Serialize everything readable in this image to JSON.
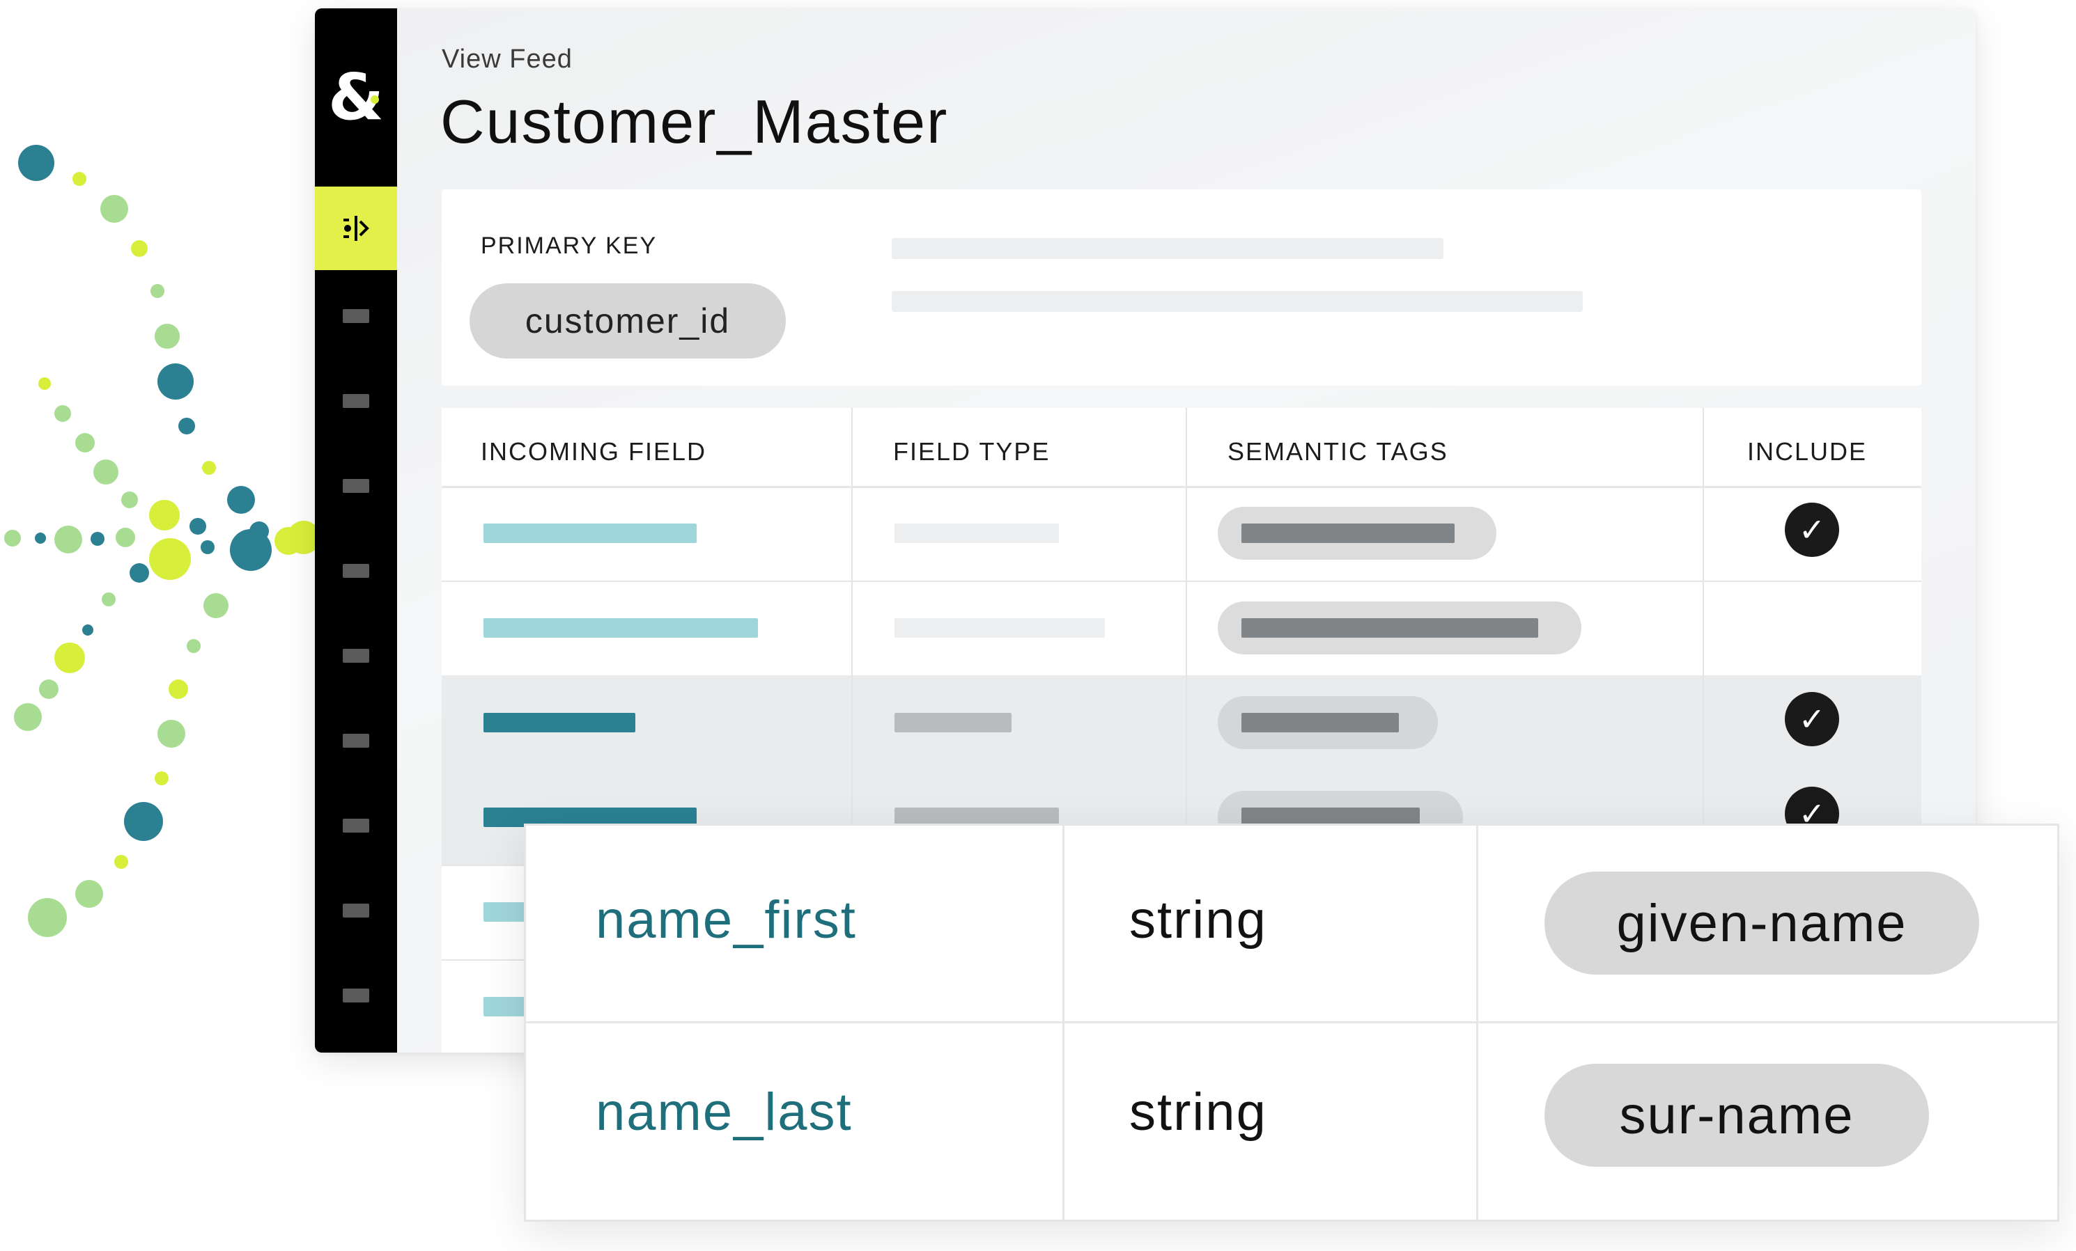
{
  "app": {
    "logo_text": "&"
  },
  "header": {
    "breadcrumb": "View Feed",
    "title": "Customer_Master"
  },
  "primary_key": {
    "label": "PRIMARY KEY",
    "value": "customer_id"
  },
  "fields_table": {
    "columns": [
      "INCOMING FIELD",
      "FIELD TYPE",
      "SEMANTIC TAGS",
      "INCLUDE"
    ],
    "rows_included": [
      true,
      false,
      true,
      true
    ]
  },
  "detail_card": {
    "rows": [
      {
        "field": "name_first",
        "type": "string",
        "tag": "given-name"
      },
      {
        "field": "name_last",
        "type": "string",
        "tag": "sur-name"
      }
    ]
  },
  "icons": {
    "check": "checkmark-icon",
    "nav_active": "merge-icon"
  },
  "colors": {
    "accent_lime": "#e4f04a",
    "teal_dark": "#1f6e7b",
    "teal_light": "#9fd6dc",
    "sidebar": "#000000"
  }
}
